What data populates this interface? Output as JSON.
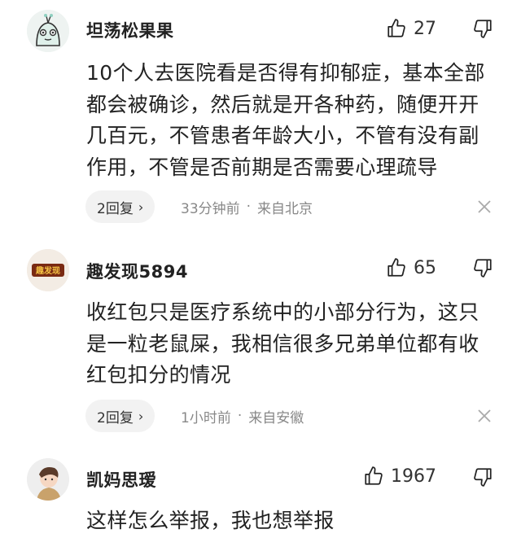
{
  "comments": [
    {
      "username": "坦荡松果果",
      "likes": "27",
      "text": "10个人去医院看是否得有抑郁症，基本全部都会被确诊，然后就是开各种药，随便开开几百元，不管患者年龄大小，不管有没有副作用，不管是否前期是否需要心理疏导",
      "reply_label": "2回复",
      "time": "33分钟前",
      "location": "来自北京"
    },
    {
      "username": "趣发现5894",
      "likes": "65",
      "text": "收红包只是医疗系统中的小部分行为，这只是一粒老鼠屎，我相信很多兄弟单位都有收红包扣分的情况",
      "reply_label": "2回复",
      "time": "1小时前",
      "location": "来自安徽"
    },
    {
      "username": "凯妈思瑷",
      "likes": "1967",
      "text": "这样怎么举报，我也想举报"
    }
  ],
  "avatar2_logo_text": "趣发现",
  "icons": {
    "like": "thumbs-up-icon",
    "dislike": "thumbs-down-icon",
    "close": "close-icon",
    "chevron": "chevron-right-icon"
  }
}
